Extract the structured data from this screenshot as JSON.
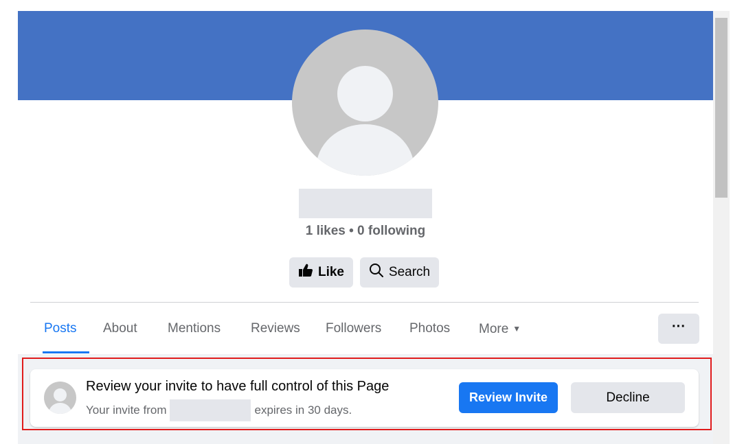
{
  "profile": {
    "stats": "1 likes • 0 following"
  },
  "actions": {
    "like_label": "Like",
    "search_label": "Search"
  },
  "tabs": [
    {
      "label": "Posts",
      "active": true
    },
    {
      "label": "About"
    },
    {
      "label": "Mentions"
    },
    {
      "label": "Reviews"
    },
    {
      "label": "Followers"
    },
    {
      "label": "Photos"
    },
    {
      "label": "More"
    }
  ],
  "overflow_label": "···",
  "invite": {
    "title": "Review your invite to have full control of this Page",
    "subtitle_prefix": "Your invite from",
    "subtitle_suffix": "expires in 30 days.",
    "review_label": "Review Invite",
    "decline_label": "Decline"
  },
  "colors": {
    "cover": "#4472c4",
    "primary": "#1877f2",
    "highlight": "#e01b1b"
  },
  "icons": [
    "thumbs-up-icon",
    "search-icon",
    "caret-down-icon",
    "more-options-icon"
  ]
}
